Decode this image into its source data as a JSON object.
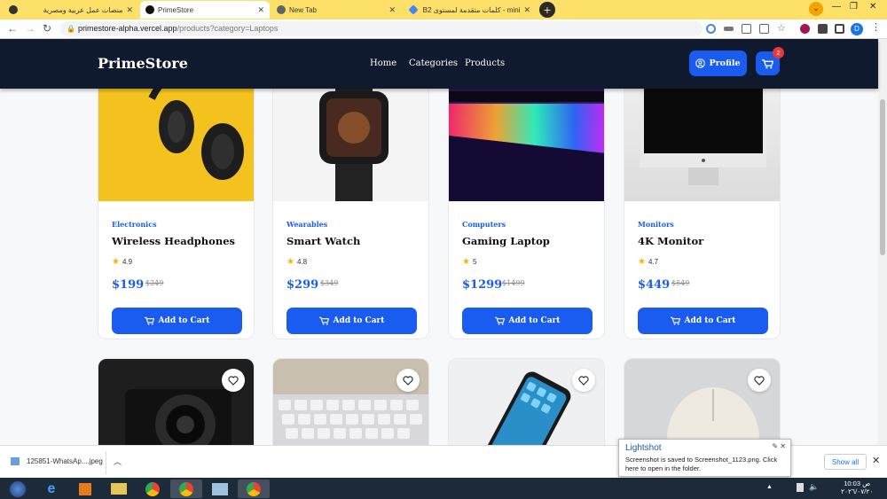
{
  "browser": {
    "tabs": [
      {
        "title": "منصات عمل عربية ومصرية",
        "fav": "#333333"
      },
      {
        "title": "PrimeStore",
        "fav": "#111111"
      },
      {
        "title": "New Tab",
        "fav": "#5f6368"
      },
      {
        "title": "mini - كلمات متقدمة لمستوى B2 الألماني",
        "fav": "#4285f4"
      }
    ],
    "new_tab": "+",
    "url_host": "primestore-alpha.vercel.app",
    "url_path": "/products?category=Laptops",
    "profile_letter": "D"
  },
  "site": {
    "logo": "PrimeStore",
    "nav": [
      "Home",
      "Categories",
      "Products"
    ],
    "profile_label": "Profile",
    "cart_count": "2",
    "accent": "#1a5cf0",
    "header_bg": "#0f1a2e"
  },
  "products": [
    {
      "category": "Electronics",
      "name": "Wireless Headphones",
      "rating": "4.9",
      "price": "$199",
      "old_price": "$249",
      "image": "headphones-on-yellow"
    },
    {
      "category": "Wearables",
      "name": "Smart Watch",
      "rating": "4.8",
      "price": "$299",
      "old_price": "$349",
      "image": "smart-watch"
    },
    {
      "category": "Computers",
      "name": "Gaming Laptop",
      "rating": "5",
      "price": "$1299",
      "old_price": "$1499",
      "image": "rgb-keyboard-laptop"
    },
    {
      "category": "Monitors",
      "name": "4K Monitor",
      "rating": "4.7",
      "price": "$449",
      "old_price": "$549",
      "image": "monitor-on-desk"
    }
  ],
  "add_to_cart_label": "Add to Cart",
  "second_row_images": [
    "camera",
    "keyboard",
    "smartphone",
    "mouse"
  ],
  "downloads": {
    "file": "125851-WhatsAp....jpeg",
    "show_all": "Show all"
  },
  "toast": {
    "title": "Lightshot",
    "message": "Screenshot is saved to Screenshot_1123.png. Click here to open in the folder."
  },
  "clock": {
    "time": "10:03 ص",
    "date": "٢٠٢٦/٠٧/٢٠"
  }
}
